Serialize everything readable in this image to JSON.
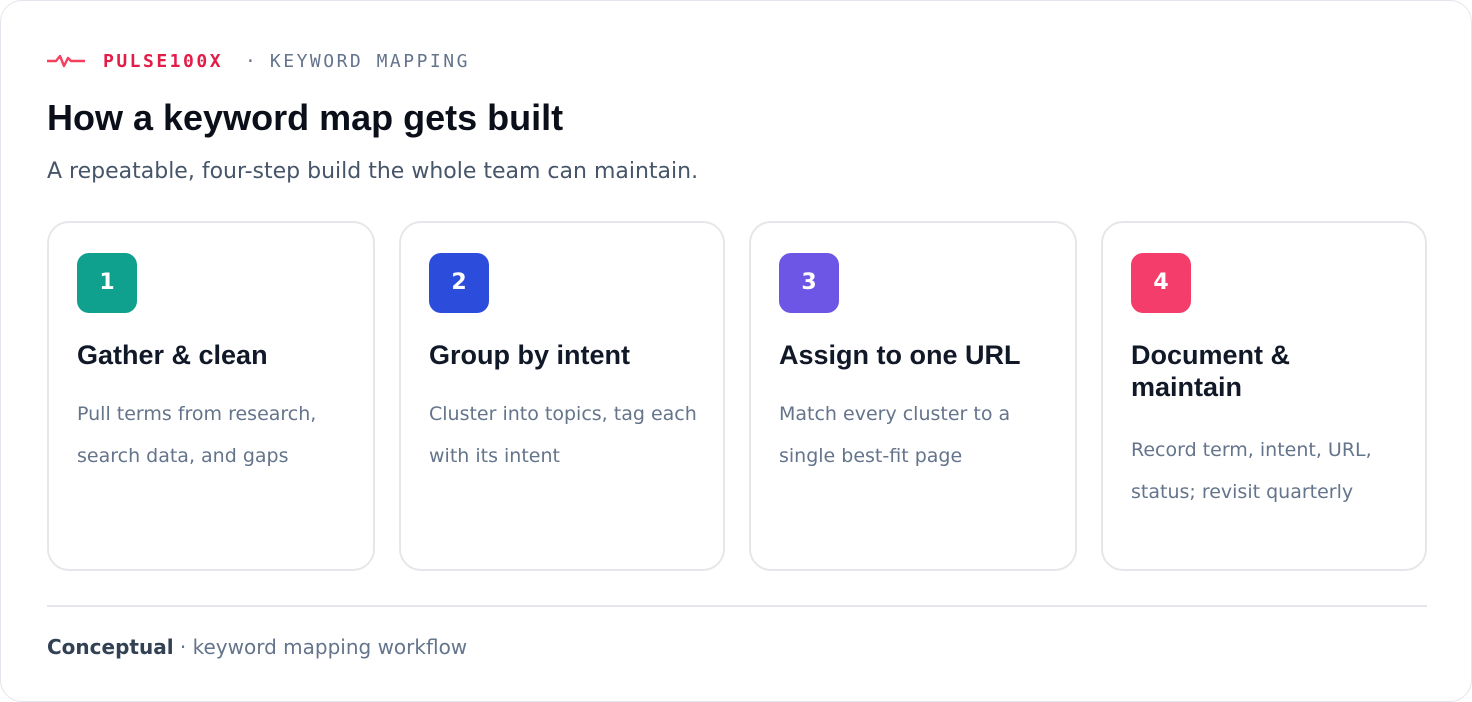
{
  "brand": {
    "name": "PULSE100X",
    "separator": "·",
    "section": "KEYWORD MAPPING",
    "icon": "pulse-icon",
    "accent_color": "#e11d48"
  },
  "title": "How a keyword map gets built",
  "subtitle": "A repeatable, four-step build the whole team can maintain.",
  "steps": [
    {
      "number": "1",
      "title": "Gather & clean",
      "description": "Pull terms from research, search data, and gaps",
      "color": "#10a08e"
    },
    {
      "number": "2",
      "title": "Group by intent",
      "description": "Cluster into topics, tag each with its intent",
      "color": "#2c4ddc"
    },
    {
      "number": "3",
      "title": "Assign to one URL",
      "description": "Match every cluster to a single best-fit page",
      "color": "#6d55e6"
    },
    {
      "number": "4",
      "title": "Document & maintain",
      "description": "Record term, intent, URL, status; revisit quarterly",
      "color": "#f43d6a"
    }
  ],
  "footer": {
    "label": "Conceptual",
    "separator": "·",
    "text": "keyword mapping workflow"
  }
}
